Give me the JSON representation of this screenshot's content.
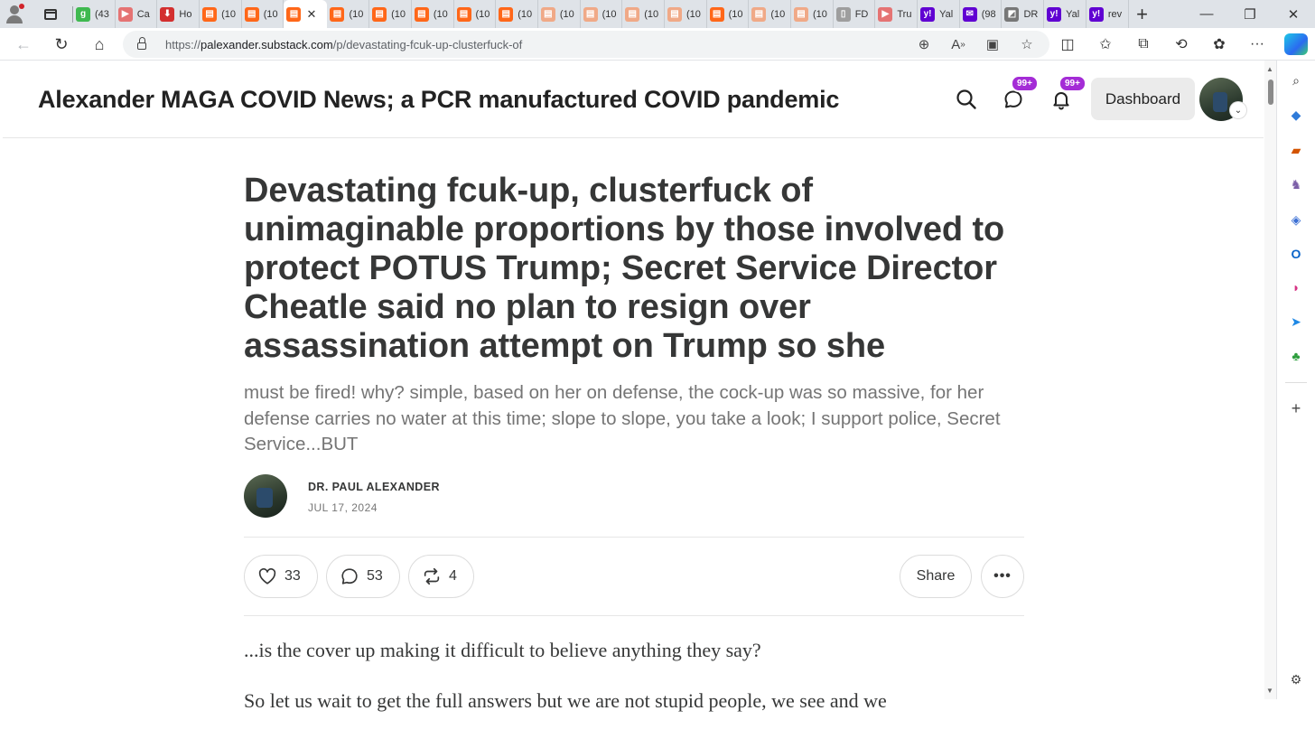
{
  "browser": {
    "tabs": [
      {
        "label": "(43",
        "color": "#3fb950",
        "glyph": "g"
      },
      {
        "label": "Ca",
        "color": "#e57373",
        "glyph": "▶"
      },
      {
        "label": "Ho",
        "color": "#d32f2f",
        "glyph": "⬇"
      },
      {
        "label": "(10",
        "color": "#ff6719",
        "glyph": "▤"
      },
      {
        "label": "(10",
        "color": "#ff6719",
        "glyph": "▤"
      },
      {
        "label": "",
        "color": "#ff6719",
        "glyph": "▤",
        "active": true
      },
      {
        "label": "(10",
        "color": "#ff6719",
        "glyph": "▤"
      },
      {
        "label": "(10",
        "color": "#ff6719",
        "glyph": "▤"
      },
      {
        "label": "(10",
        "color": "#ff6719",
        "glyph": "▤"
      },
      {
        "label": "(10",
        "color": "#ff6719",
        "glyph": "▤"
      },
      {
        "label": "(10",
        "color": "#ff6719",
        "glyph": "▤"
      },
      {
        "label": "(10",
        "color": "#f0a987",
        "glyph": "▤"
      },
      {
        "label": "(10",
        "color": "#f0a987",
        "glyph": "▤"
      },
      {
        "label": "(10",
        "color": "#f0a987",
        "glyph": "▤"
      },
      {
        "label": "(10",
        "color": "#f0a987",
        "glyph": "▤"
      },
      {
        "label": "(10",
        "color": "#ff6719",
        "glyph": "▤"
      },
      {
        "label": "(10",
        "color": "#f0a987",
        "glyph": "▤"
      },
      {
        "label": "(10",
        "color": "#f0a987",
        "glyph": "▤"
      },
      {
        "label": "FD",
        "color": "#9e9e9e",
        "glyph": "▯"
      },
      {
        "label": "Tru",
        "color": "#e57373",
        "glyph": "▶"
      },
      {
        "label": "Yal",
        "color": "#6001d2",
        "glyph": "y!"
      },
      {
        "label": "(98",
        "color": "#6001d2",
        "glyph": "✉"
      },
      {
        "label": "DR",
        "color": "#777777",
        "glyph": "◩"
      },
      {
        "label": "Yal",
        "color": "#6001d2",
        "glyph": "y!"
      },
      {
        "label": "rev",
        "color": "#6001d2",
        "glyph": "y!"
      }
    ],
    "url_prefix": "https://",
    "url_host": "palexander.substack.com",
    "url_path": "/p/devastating-fcuk-up-clusterfuck-of"
  },
  "publication": {
    "title": "Alexander MAGA COVID News; a PCR manufactured COVID pandemic",
    "chat_badge": "99+",
    "notif_badge": "99+",
    "dashboard_label": "Dashboard"
  },
  "post": {
    "title": "Devastating fcuk-up, clusterfuck of unimaginable proportions by those involved to protect POTUS Trump; Secret Service Director Cheatle said no plan to resign over assassination attempt on Trump so she",
    "subtitle": "must be fired! why? simple, based on her on defense, the cock-up was so massive, for her defense carries no water at this time; slope to slope, you take a look; I support police, Secret Service...BUT",
    "author": "DR. PAUL ALEXANDER",
    "date": "JUL 17, 2024",
    "likes": "33",
    "comments": "53",
    "restacks": "4",
    "share_label": "Share",
    "more_label": "•••",
    "body": [
      "...is the cover up making it difficult to believe anything they say?",
      "So let us wait to get the full answers but we are not stupid people, we see and we"
    ]
  }
}
